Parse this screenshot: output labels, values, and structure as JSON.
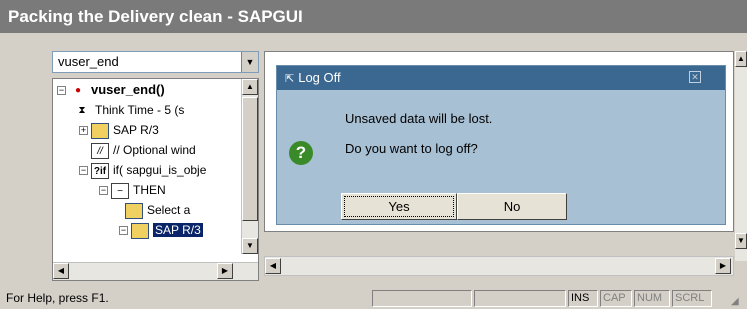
{
  "window": {
    "title": "Packing the Delivery clean - SAPGUI"
  },
  "sidebar": {
    "combo_value": "vuser_end",
    "tree": [
      {
        "label": "vuser_end()",
        "bold": true
      },
      {
        "label": "Think Time - 5 (s"
      },
      {
        "label": "SAP R/3"
      },
      {
        "label": "// Optional wind"
      },
      {
        "label": "if( sapgui_is_obje"
      },
      {
        "label": "THEN"
      },
      {
        "label": "Select a"
      },
      {
        "label": "SAP R/3",
        "selected": true
      }
    ]
  },
  "dialog": {
    "title": "Log Off",
    "message_line1": "Unsaved data will be lost.",
    "message_line2": "Do you want to log off?",
    "yes_label": "Yes",
    "no_label": "No"
  },
  "statusbar": {
    "help_text": "For Help, press F1.",
    "indicators": [
      "INS",
      "CAP",
      "NUM",
      "SCRL"
    ]
  },
  "colors": {
    "titlebar": "#7a7a7a",
    "dialog_bg": "#a8c0d4",
    "dialog_title": "#3a6890",
    "selection": "#0a246a"
  }
}
